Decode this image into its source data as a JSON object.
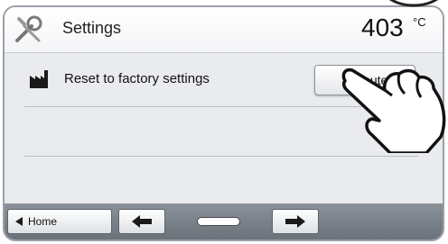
{
  "header": {
    "title": "Settings",
    "temperature_value": "403",
    "temperature_unit": "°C",
    "icon": "tools-icon"
  },
  "setting_row": {
    "icon": "factory-icon",
    "label": "Reset to factory settings",
    "action_label": "Execute"
  },
  "footer": {
    "home_label": "Home",
    "home_icon": "triangle-left-icon",
    "prev_icon": "arrow-left-icon",
    "next_icon": "arrow-right-icon"
  },
  "colors": {
    "screen_bg": "#e9ebee",
    "footer_bg": "#7c828a",
    "accent_dark": "#1a1a1a"
  }
}
